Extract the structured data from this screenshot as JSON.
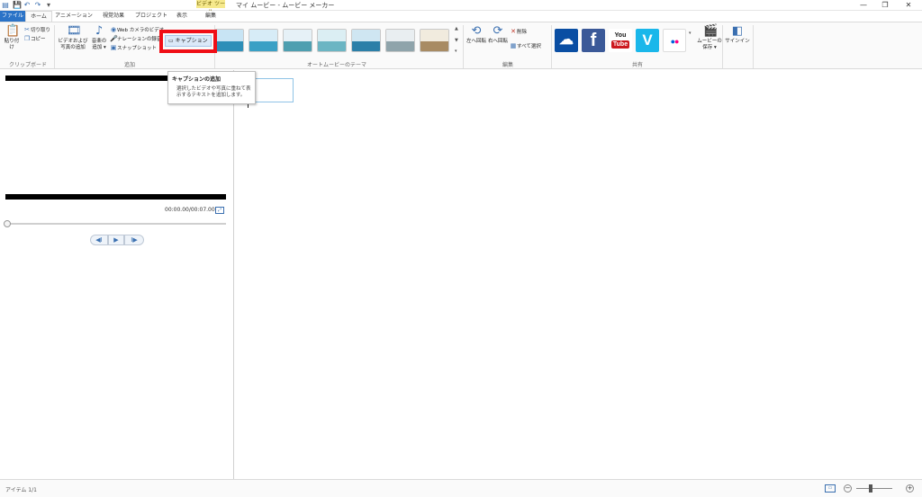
{
  "app_title": "マイ ムービー - ムービー メーカー",
  "contextual_tab": "ビデオ ツール",
  "window": {
    "minimize": "—",
    "maximize": "❐",
    "close": "✕"
  },
  "quick_access": {
    "app": "▤",
    "save": "💾",
    "undo": "↶",
    "redo": "↷",
    "dropdown": "▾"
  },
  "tabs": {
    "file": "ファイル",
    "home": "ホーム",
    "animations": "アニメーション",
    "visual_effects": "視覚効果",
    "project": "プロジェクト",
    "view": "表示",
    "edit": "編集"
  },
  "ribbon": {
    "clipboard": {
      "paste": "貼り付け",
      "cut": "切り取り",
      "copy": "コピー",
      "label": "クリップボード"
    },
    "add": {
      "add_videos_photos": "ビデオおよび写真の追加",
      "add_music": "音楽の追加 ▾",
      "webcam": "Web カメラのビデオ",
      "narration": "ナレーションの録音",
      "snapshot": "スナップショット",
      "caption": "キャプション",
      "label": "追加"
    },
    "auto_themes": {
      "label": "オートムービーのテーマ"
    },
    "editing": {
      "rotate_left": "左へ回転",
      "rotate_right": "右へ回転",
      "delete": "削除",
      "select_all": "すべて選択",
      "label": "編集"
    },
    "share": {
      "onedrive": "☁",
      "facebook": "f",
      "youtube_top": "You",
      "youtube_bottom": "Tube",
      "vimeo": "V",
      "flickr": "●●",
      "save_movie": "ムービーの保存 ▾",
      "label": "共有"
    },
    "signin": "サインイン"
  },
  "tooltip": {
    "title": "キャプションの追加",
    "description": "選択したビデオや写真に重ねて表示するテキストを追加します。"
  },
  "preview": {
    "timecode": "00:00.00/00:07.00",
    "fullscreen": "⤢",
    "controls": {
      "previous": "◀I",
      "play": "▶",
      "next": "I▶"
    },
    "progress": 0.0
  },
  "status": {
    "items": "アイテム 1/1",
    "aspect": "▭",
    "zoom_out": "−",
    "zoom_in": "+",
    "zoom_level": 0.4
  },
  "colors": {
    "accent": "#2b73c7",
    "highlight": "#f00e16",
    "facebook": "#3b5998",
    "youtube": "#cc181e",
    "vimeo": "#1ab7ea",
    "onedrive": "#0a4ea3"
  }
}
